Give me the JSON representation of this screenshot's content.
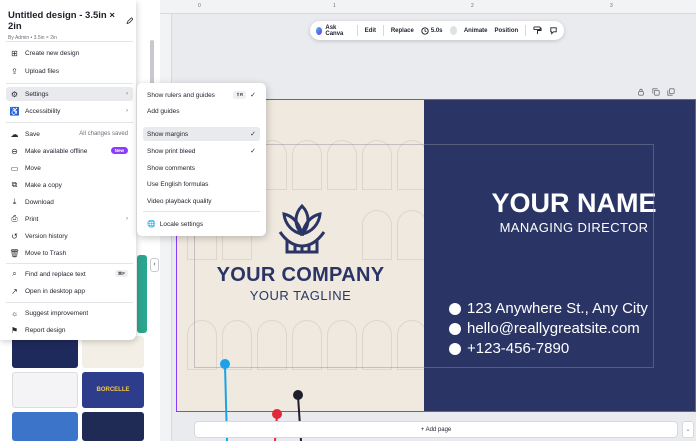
{
  "menu": {
    "title": "Untitled design - 3.5in × 2in",
    "subtitle": "By Admin • 3.5in × 2in",
    "items": [
      {
        "label": "Create new design"
      },
      {
        "label": "Upload files"
      },
      {
        "label": "Settings"
      },
      {
        "label": "Accessibility"
      },
      {
        "label": "Save",
        "status": "All changes saved"
      },
      {
        "label": "Make available offline",
        "badge": "New"
      },
      {
        "label": "Move"
      },
      {
        "label": "Make a copy"
      },
      {
        "label": "Download"
      },
      {
        "label": "Print"
      },
      {
        "label": "Version history"
      },
      {
        "label": "Move to Trash"
      },
      {
        "label": "Find and replace text",
        "shortcut": "⌘F"
      },
      {
        "label": "Open in desktop app"
      },
      {
        "label": "Suggest improvement"
      },
      {
        "label": "Report design"
      }
    ]
  },
  "settings_menu": {
    "items": [
      {
        "label": "Show rulers and guides",
        "shortcut": "⇧R"
      },
      {
        "label": "Add guides"
      },
      {
        "label": "Show margins"
      },
      {
        "label": "Show print bleed"
      },
      {
        "label": "Show comments"
      },
      {
        "label": "Use English formulas"
      },
      {
        "label": "Video playback quality"
      },
      {
        "label": "Locale settings"
      }
    ]
  },
  "toolbar": {
    "ask_canva": "Ask Canva",
    "edit": "Edit",
    "replace": "Replace",
    "duration": "5.0s",
    "animate": "Animate",
    "position": "Position"
  },
  "ruler": {
    "marks": [
      "0",
      "1",
      "2",
      "3"
    ]
  },
  "design": {
    "company": "YOUR COMPANY",
    "tagline": "YOUR TAGLINE",
    "name": "YOUR NAME",
    "title": "MANAGING DIRECTOR",
    "address": "123 Anywhere St., Any City",
    "email": "hello@reallygreatsite.com",
    "phone": "+123-456-7890"
  },
  "templates": {
    "t1_name": "BORCELLE"
  },
  "add_page": "+ Add page",
  "colors": {
    "navy": "#2a3565",
    "cream": "#efe9df",
    "accent": "#8b3dff"
  }
}
